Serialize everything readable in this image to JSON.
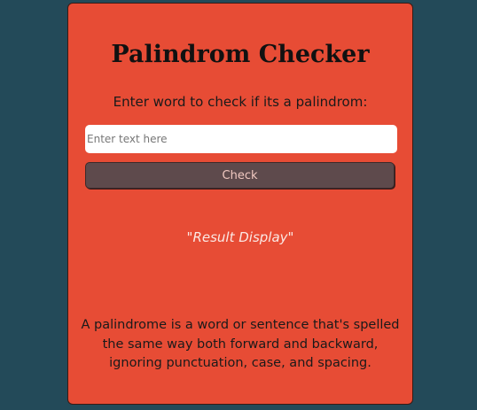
{
  "app": {
    "title": "Palindrom Checker",
    "prompt": "Enter word to check if its a palindrom:",
    "input": {
      "value": "",
      "placeholder": "Enter text here"
    },
    "check_button": "Check",
    "result": "\"Result Display\"",
    "info": "A palindrome is a word or sentence that's spelled the same way both forward and backward, ignoring punctuation, case, and spacing."
  },
  "colors": {
    "background": "#234a59",
    "card": "#e74c35",
    "button": "#5e4a4c"
  }
}
